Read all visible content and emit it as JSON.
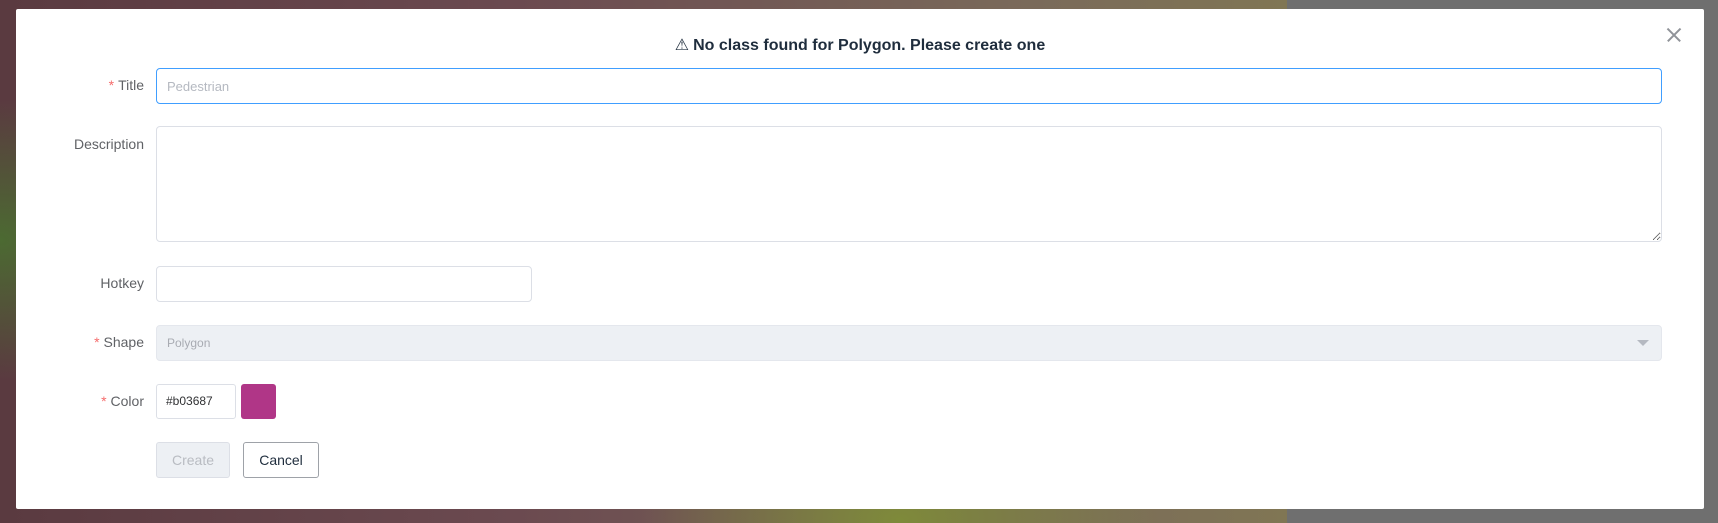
{
  "dialog": {
    "title": "No class found for Polygon. Please create one",
    "warning_icon": "⚠"
  },
  "form": {
    "title_label": "Title",
    "title_placeholder": "Pedestrian",
    "title_value": "",
    "description_label": "Description",
    "description_value": "",
    "hotkey_label": "Hotkey",
    "hotkey_value": "",
    "shape_label": "Shape",
    "shape_value": "Polygon",
    "color_label": "Color",
    "color_value": "#b03687",
    "required_mark": "*"
  },
  "buttons": {
    "create_label": "Create",
    "cancel_label": "Cancel"
  },
  "colors": {
    "swatch": "#b03687",
    "required": "#f56c6c",
    "focus_border": "#409eff"
  }
}
